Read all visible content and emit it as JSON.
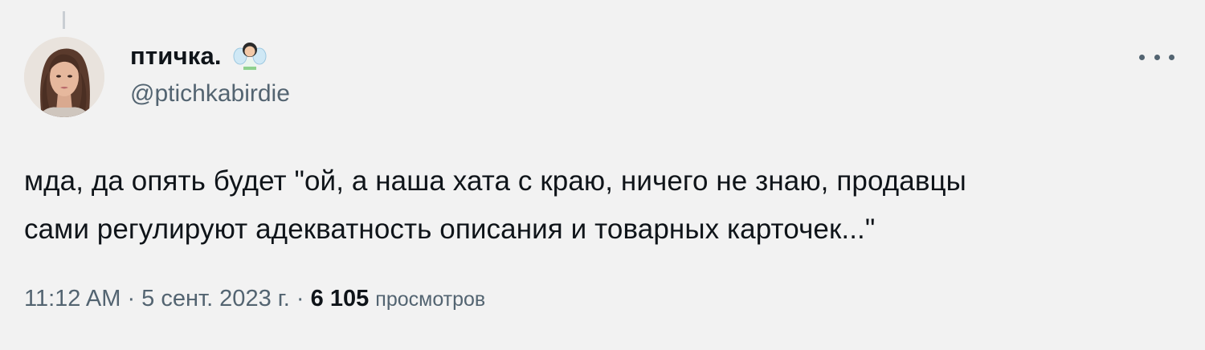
{
  "author": {
    "display_name": "птичка.",
    "handle": "@ptichkabirdie",
    "avatar": "woman-portrait-avatar",
    "badge_emoji": "fairy-emoji"
  },
  "tweet": {
    "text_line1": "мда, да опять будет \"ой, а наша хата с краю, ничего не знаю, продавцы",
    "text_line2": "сами регулируют адекватность описания и товарных карточек...\""
  },
  "meta": {
    "time": "11:12 AM",
    "separator1": "·",
    "date": "5 сент. 2023 г.",
    "separator2": "·",
    "views_count": "6 105",
    "views_label": "просмотров"
  },
  "icons": {
    "more": "more-horizontal-icon"
  },
  "colors": {
    "background": "#f2f2f2",
    "text": "#0f1419",
    "secondary": "#536471"
  }
}
